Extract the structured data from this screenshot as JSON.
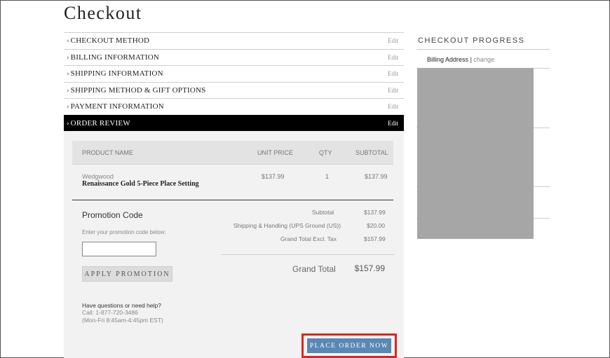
{
  "page": {
    "title": "Checkout"
  },
  "steps": [
    {
      "label": "CHECKOUT METHOD",
      "edit": "Edit",
      "active": false
    },
    {
      "label": "BILLING INFORMATION",
      "edit": "Edit",
      "active": false
    },
    {
      "label": "SHIPPING INFORMATION",
      "edit": "Edit",
      "active": false
    },
    {
      "label": "SHIPPING METHOD & GIFT OPTIONS",
      "edit": "Edit",
      "active": false
    },
    {
      "label": "PAYMENT INFORMATION",
      "edit": "Edit",
      "active": false
    },
    {
      "label": "ORDER REVIEW",
      "edit": "Edit",
      "active": true
    }
  ],
  "step_chevron": "›",
  "order_table": {
    "headers": {
      "product": "PRODUCT NAME",
      "unit_price": "UNIT PRICE",
      "qty": "QTY",
      "subtotal": "SUBTOTAL"
    },
    "items": [
      {
        "brand": "Wedgwood",
        "name": "Renaissance Gold 5-Piece Place Setting",
        "unit_price": "$137.99",
        "qty": "1",
        "subtotal": "$137.99"
      }
    ]
  },
  "promotion": {
    "title": "Promotion Code",
    "hint": "Enter your promotion code below:",
    "input_value": "",
    "button_label": "APPLY PROMOTION"
  },
  "totals": {
    "subtotal_label": "Subtotal",
    "subtotal_value": "$137.99",
    "shipping_label": "Shipping & Handling (UPS Ground (US))",
    "shipping_value": "$20.00",
    "excl_tax_label": "Grand Total Excl. Tax",
    "excl_tax_value": "$157.99",
    "grand_label": "Grand Total",
    "grand_value": "$157.99"
  },
  "help": {
    "question": "Have questions or need help?",
    "phone": "Call: 1-877-720-3486",
    "hours": "(Mon-Fri 8:45am-4:45pm EST)"
  },
  "place_order": {
    "label": "PLACE ORDER NOW"
  },
  "progress": {
    "title": "CHECKOUT PROGRESS",
    "billing_label": "Billing Address",
    "separator": "|",
    "change_label": "change"
  },
  "colors": {
    "active_step_bg": "#000000",
    "place_order_bg": "#5a88b5",
    "highlight_border": "#e2231a",
    "redacted_box": "#a6a6a6"
  }
}
